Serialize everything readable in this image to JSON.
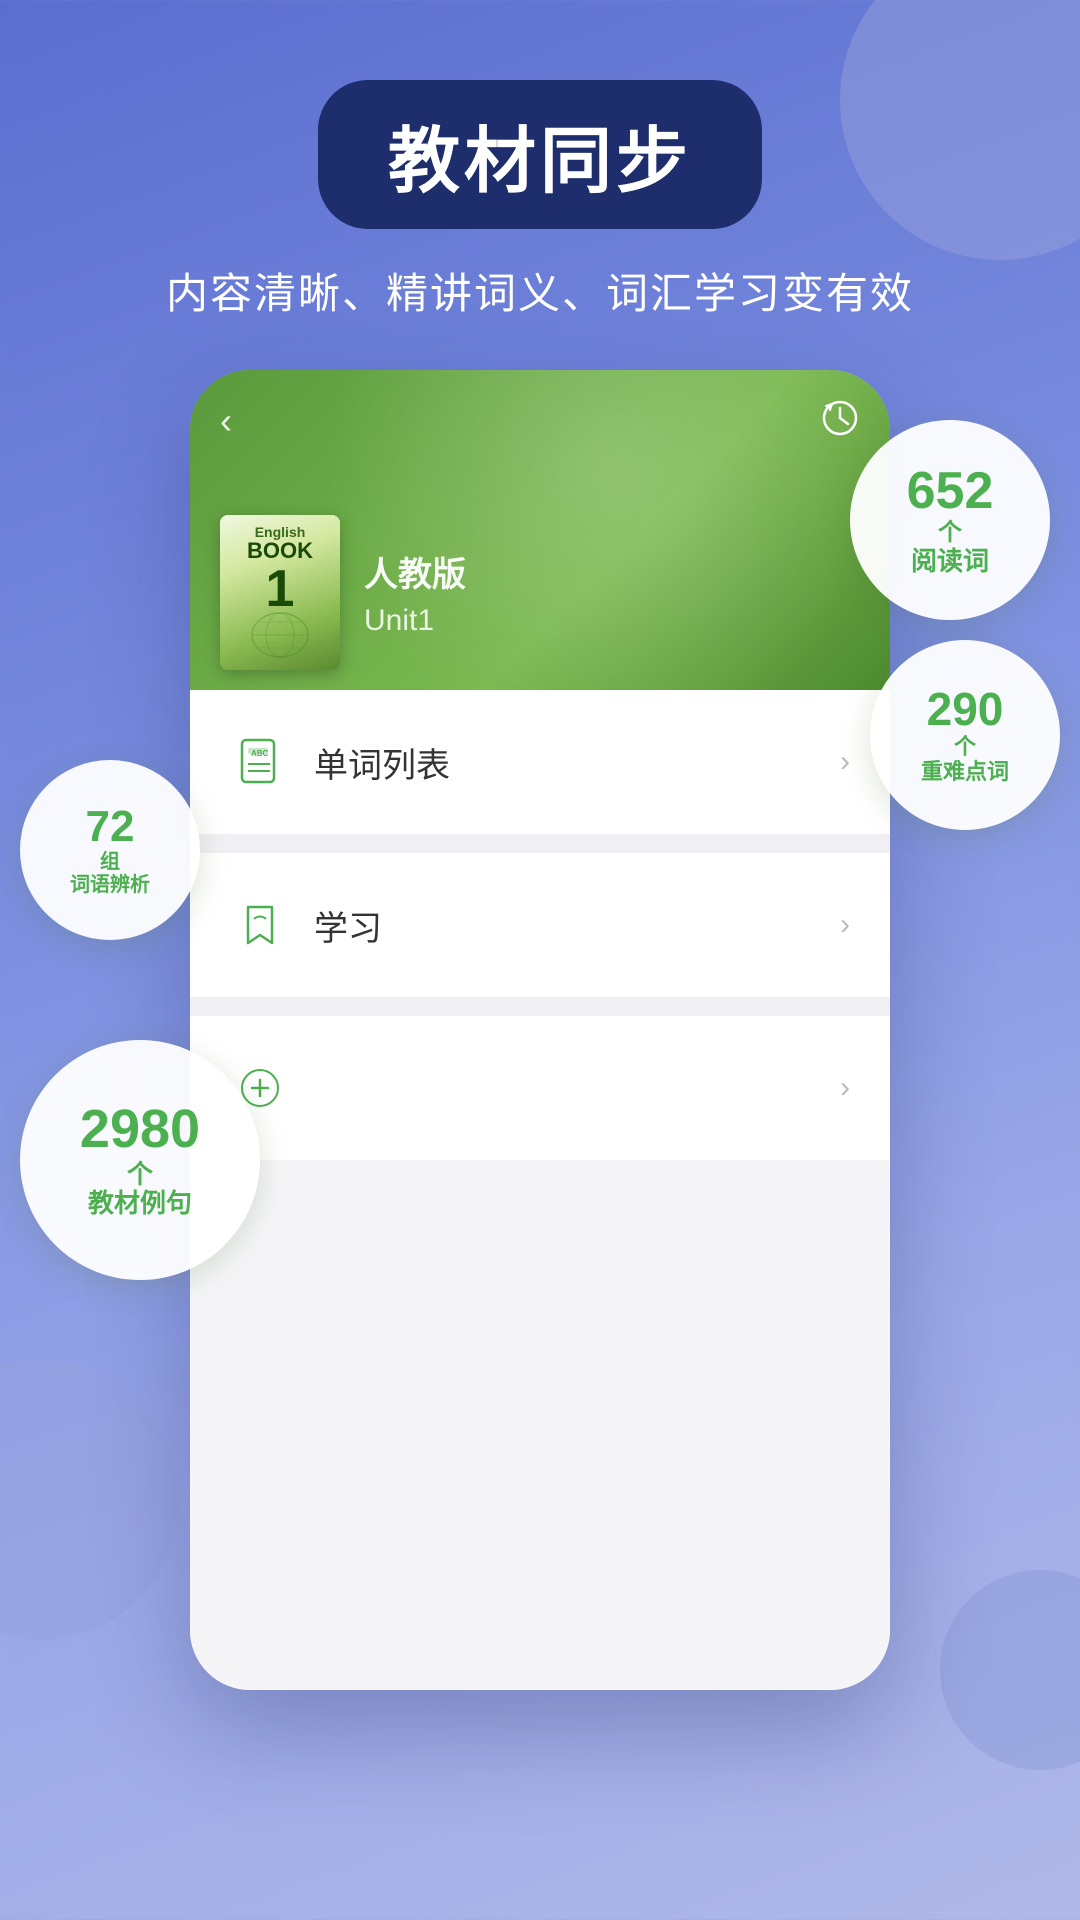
{
  "background": {
    "gradient_start": "#5b6ecf",
    "gradient_end": "#b0b8e8"
  },
  "title_badge": {
    "text": "教材同步",
    "bg_color": "#1e2d6b"
  },
  "subtitle": {
    "text": "内容清晰、精讲词义、词汇学习变有效"
  },
  "phone": {
    "back_btn": "‹",
    "history_icon": "⏱",
    "book_cover": {
      "english_label": "English",
      "book_label": "BOOK",
      "number": "1"
    },
    "publisher": "人教版",
    "unit": "Unit1",
    "menu_items": [
      {
        "label": "单词列表",
        "icon": "list-icon"
      },
      {
        "label": "学习",
        "icon": "bookmark-icon"
      },
      {
        "label": "",
        "icon": "more-icon"
      }
    ],
    "chevron": "›"
  },
  "bubbles": [
    {
      "id": "bubble-652",
      "number": "652",
      "unit": "个",
      "desc": "阅读词",
      "position": "top-right"
    },
    {
      "id": "bubble-290",
      "number": "290",
      "unit": "个",
      "desc": "重难点词",
      "position": "mid-right"
    },
    {
      "id": "bubble-72",
      "number": "72",
      "unit": "组",
      "desc": "词语辨析",
      "position": "left"
    },
    {
      "id": "bubble-2980",
      "number": "2980",
      "unit": "个",
      "desc": "教材例句",
      "position": "bottom-left"
    }
  ]
}
